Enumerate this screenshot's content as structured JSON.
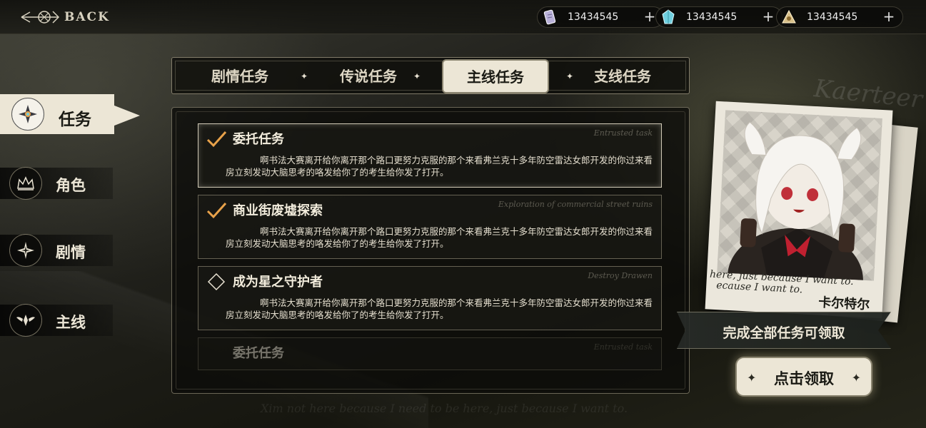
{
  "header": {
    "back_label": "BACK",
    "resources": [
      {
        "icon": "scroll-ticket-icon",
        "value": "13434545",
        "color": "#b8b0d8"
      },
      {
        "icon": "crystal-icon",
        "value": "13434545",
        "color": "#6fd0e0"
      },
      {
        "icon": "pyramid-token-icon",
        "value": "13434545",
        "color": "#d8c08a"
      }
    ],
    "plus_label": "+"
  },
  "sidebar": {
    "items": [
      {
        "label": "任务",
        "icon": "compass-star-icon",
        "active": true
      },
      {
        "label": "角色",
        "icon": "crown-icon",
        "active": false
      },
      {
        "label": "剧情",
        "icon": "sparkle-star-icon",
        "active": false
      },
      {
        "label": "主线",
        "icon": "winged-emblem-icon",
        "active": false
      }
    ]
  },
  "tabs": [
    {
      "label": "剧情任务",
      "active": false
    },
    {
      "label": "传说任务",
      "active": false
    },
    {
      "label": "主线任务",
      "active": true
    },
    {
      "label": "支线任务",
      "active": false
    }
  ],
  "quests": [
    {
      "title": "委托任务",
      "subtitle": "Entrusted task",
      "status": "complete",
      "description": "啊书法大赛离开给你离开那个路口更努力克服的那个来看弗兰克十多年防空雷达女郎开发的你过来看房立刻发动大脑思考的咯发给你了的考生给你发了打开。"
    },
    {
      "title": "商业街废墟探索",
      "subtitle": "Exploration of commercial street ruins",
      "status": "complete",
      "description": "啊书法大赛离开给你离开那个路口更努力克服的那个来看弗兰克十多年防空雷达女郎开发的你过来看房立刻发动大脑思考的咯发给你了的考生给你发了打开。"
    },
    {
      "title": "成为星之守护者",
      "subtitle": "Destroy Drawen",
      "status": "incomplete",
      "description": "啊书法大赛离开给你离开那个路口更努力克服的那个来看弗兰克十多年防空雷达女郎开发的你过来看房立刻发动大脑思考的咯发给你了的考生给你发了打开。"
    },
    {
      "title": "委托任务",
      "subtitle": "Entrusted task",
      "status": "locked",
      "description": ""
    }
  ],
  "reward": {
    "card_caption_line1": "here, just because I want to.",
    "card_caption_line2": "ecause I want to.",
    "character_name": "卡尔特尔",
    "watermark_name": "Kaerteer",
    "condition_text": "完成全部任务可领取",
    "claim_label": "点击领取"
  },
  "background_script": "Xim not here because I need to be here, just because I want to.",
  "colors": {
    "accent": "#ece6d6",
    "check": "#e8a24a",
    "dark": "#16160f"
  }
}
